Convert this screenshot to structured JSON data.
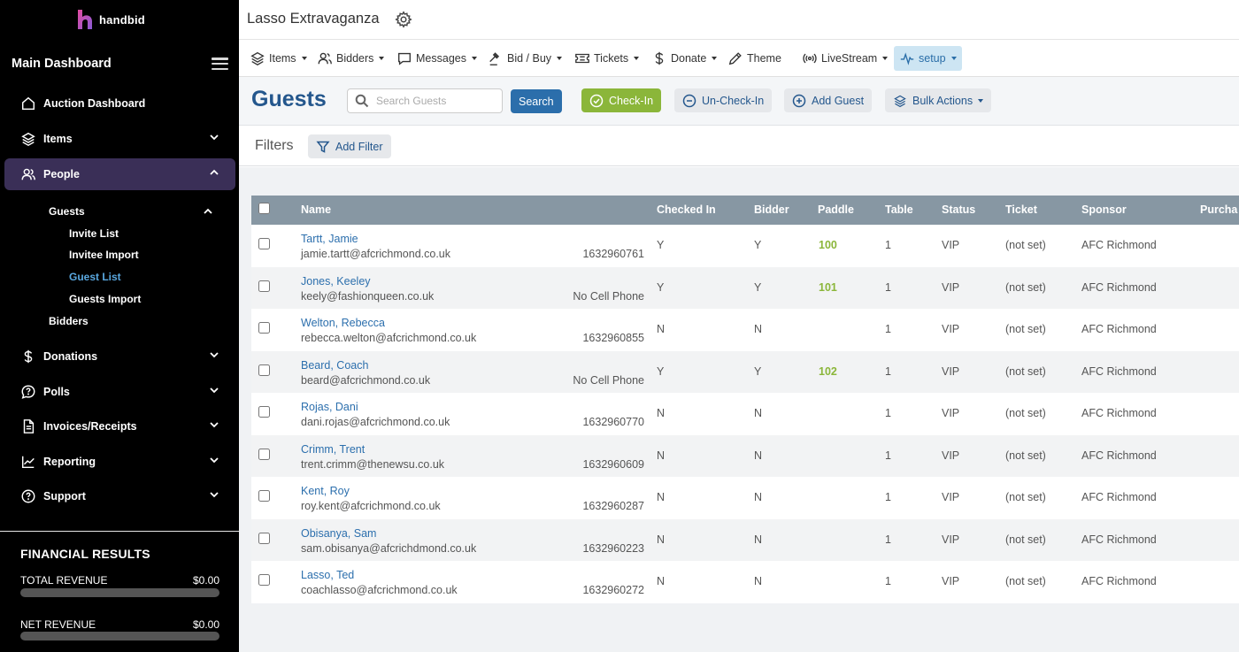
{
  "brand": {
    "logo_text": "handbid"
  },
  "sidebar": {
    "title": "Main Dashboard",
    "items": [
      {
        "label": "Auction Dashboard"
      },
      {
        "label": "Items"
      },
      {
        "label": "People"
      },
      {
        "label": "Donations"
      },
      {
        "label": "Polls"
      },
      {
        "label": "Invoices/Receipts"
      },
      {
        "label": "Reporting"
      },
      {
        "label": "Support"
      }
    ],
    "people_sub": {
      "guests": "Guests",
      "invite_list": "Invite List",
      "invitee_import": "Invitee Import",
      "guest_list": "Guest List",
      "guests_import": "Guests Import",
      "bidders": "Bidders"
    },
    "financial": {
      "title": "FINANCIAL RESULTS",
      "total_label": "TOTAL REVENUE",
      "total_value": "$0.00",
      "net_label": "NET REVENUE",
      "net_value": "$0.00",
      "total_progress": 0,
      "net_progress": 0
    }
  },
  "header": {
    "event_title": "Lasso Extravaganza"
  },
  "menu": {
    "items": "Items",
    "bidders": "Bidders",
    "messages": "Messages",
    "bidbuy": "Bid / Buy",
    "tickets": "Tickets",
    "donate": "Donate",
    "theme": "Theme",
    "livestream": "LiveStream",
    "setup": "setup"
  },
  "page": {
    "title": "Guests",
    "search_placeholder": "Search Guests",
    "search_button": "Search",
    "checkin": "Check-In",
    "uncheckin": "Un-Check-In",
    "add_guest": "Add Guest",
    "bulk_actions": "Bulk Actions",
    "filters_label": "Filters",
    "add_filter": "Add Filter"
  },
  "table": {
    "headers": {
      "name": "Name",
      "checked_in": "Checked In",
      "bidder": "Bidder",
      "paddle": "Paddle",
      "table": "Table",
      "status": "Status",
      "ticket": "Ticket",
      "sponsor": "Sponsor",
      "purchase": "Purcha"
    },
    "rows": [
      {
        "name": "Tartt, Jamie",
        "email": "jamie.tartt@afcrichmond.co.uk",
        "phone": "1632960761",
        "checked_in": "Y",
        "bidder": "Y",
        "paddle": "100",
        "table": "1",
        "status": "VIP",
        "ticket": "(not set)",
        "sponsor": "AFC Richmond"
      },
      {
        "name": "Jones, Keeley",
        "email": "keely@fashionqueen.co.uk",
        "phone": "No Cell Phone",
        "checked_in": "Y",
        "bidder": "Y",
        "paddle": "101",
        "table": "1",
        "status": "VIP",
        "ticket": "(not set)",
        "sponsor": "AFC Richmond"
      },
      {
        "name": "Welton, Rebecca",
        "email": "rebecca.welton@afcrichmond.co.uk",
        "phone": "1632960855",
        "checked_in": "N",
        "bidder": "N",
        "paddle": "",
        "table": "1",
        "status": "VIP",
        "ticket": "(not set)",
        "sponsor": "AFC Richmond"
      },
      {
        "name": "Beard, Coach",
        "email": "beard@afcrichmond.co.uk",
        "phone": "No Cell Phone",
        "checked_in": "Y",
        "bidder": "Y",
        "paddle": "102",
        "table": "1",
        "status": "VIP",
        "ticket": "(not set)",
        "sponsor": "AFC Richmond"
      },
      {
        "name": "Rojas, Dani",
        "email": "dani.rojas@afcrichmond.co.uk",
        "phone": "1632960770",
        "checked_in": "N",
        "bidder": "N",
        "paddle": "",
        "table": "1",
        "status": "VIP",
        "ticket": "(not set)",
        "sponsor": "AFC Richmond"
      },
      {
        "name": "Crimm, Trent",
        "email": "trent.crimm@thenewsu.co.uk",
        "phone": "1632960609",
        "checked_in": "N",
        "bidder": "N",
        "paddle": "",
        "table": "1",
        "status": "VIP",
        "ticket": "(not set)",
        "sponsor": "AFC Richmond"
      },
      {
        "name": "Kent, Roy",
        "email": "roy.kent@afcrichmond.co.uk",
        "phone": "1632960287",
        "checked_in": "N",
        "bidder": "N",
        "paddle": "",
        "table": "1",
        "status": "VIP",
        "ticket": "(not set)",
        "sponsor": "AFC Richmond"
      },
      {
        "name": "Obisanya, Sam",
        "email": "sam.obisanya@afcrichdmond.co.uk",
        "phone": "1632960223",
        "checked_in": "N",
        "bidder": "N",
        "paddle": "",
        "table": "1",
        "status": "VIP",
        "ticket": "(not set)",
        "sponsor": "AFC Richmond"
      },
      {
        "name": "Lasso, Ted",
        "email": "coachlasso@afcrichmond.co.uk",
        "phone": "1632960272",
        "checked_in": "N",
        "bidder": "N",
        "paddle": "",
        "table": "1",
        "status": "VIP",
        "ticket": "(not set)",
        "sponsor": "AFC Richmond"
      }
    ]
  },
  "colors": {
    "sidebar_bg": "#000000",
    "active_nav": "#3a2f57",
    "title_blue": "#24578d",
    "link_blue": "#2c6fad",
    "checkin_green": "#8bb63a",
    "table_header": "#8797a3"
  }
}
